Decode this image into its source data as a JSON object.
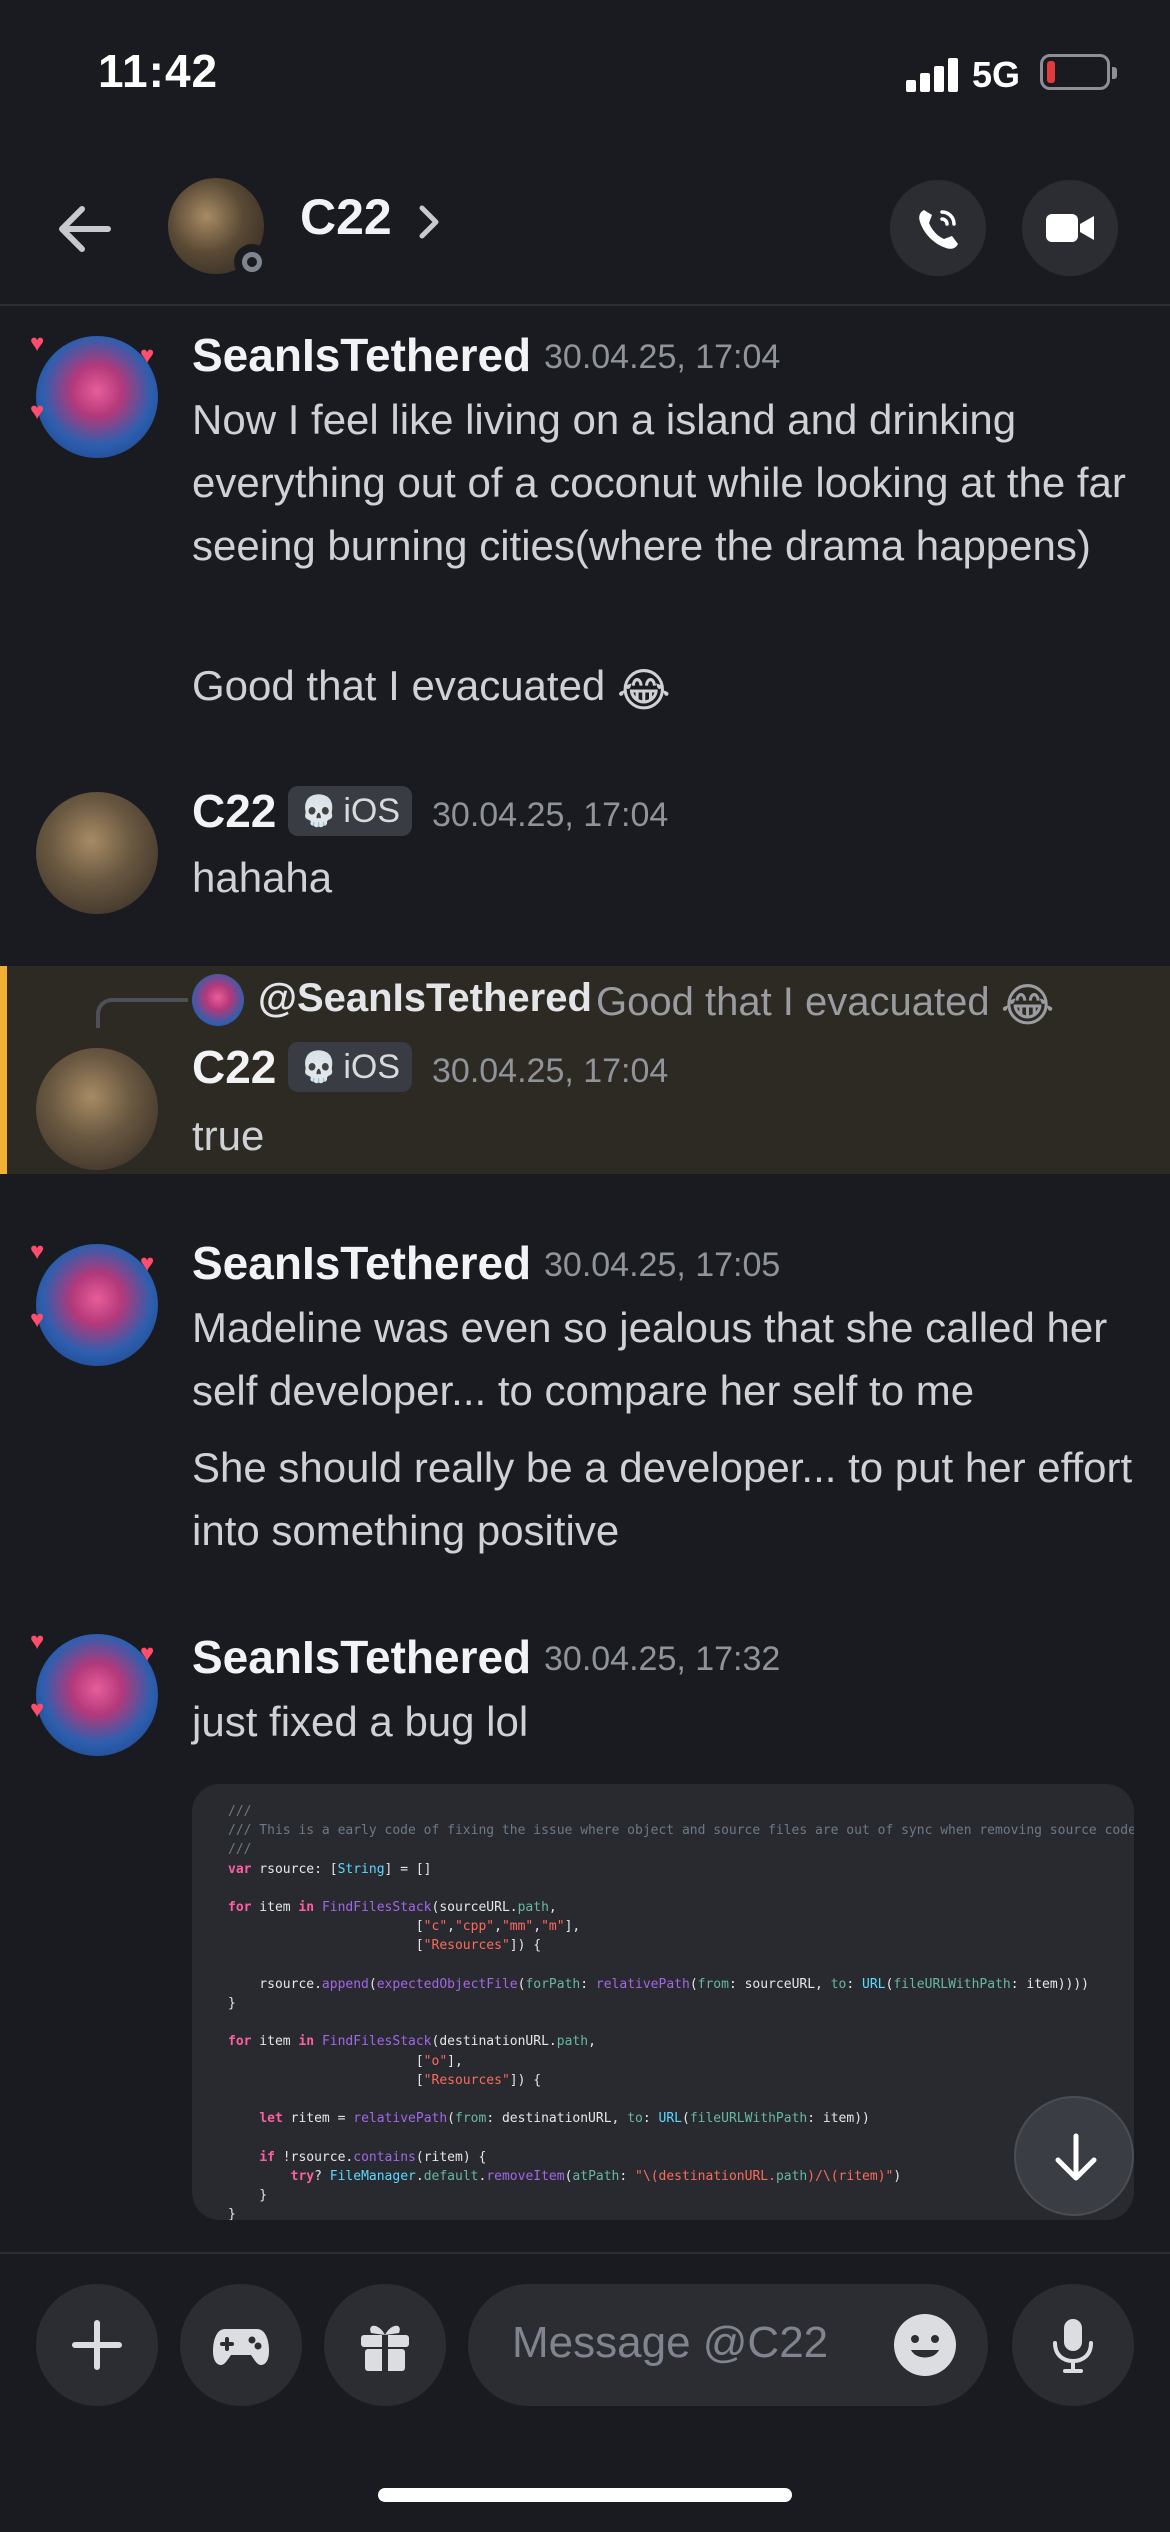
{
  "status_bar": {
    "time": "11:42",
    "network": "5G"
  },
  "header": {
    "title": "C22",
    "icons": {
      "back": "arrow-left-icon",
      "chevron": "chevron-right-icon",
      "call": "phone-icon",
      "video": "video-camera-icon"
    }
  },
  "messages": [
    {
      "author": "SeanIsTethered",
      "timestamp": "30.04.25, 17:04",
      "lines": [
        "Now I feel like living on a island and drinking everything out of a coconut while looking at the far seeing burning cities(where the drama happens)",
        "Good that I evacuated"
      ],
      "emoji": "😂"
    },
    {
      "author": "C22",
      "tag": "iOS",
      "timestamp": "30.04.25, 17:04",
      "lines": [
        "hahaha"
      ]
    },
    {
      "reply_to": {
        "author": "@SeanIsTethered",
        "preview": "Good that I evacuated",
        "emoji": "😂"
      },
      "author": "C22",
      "tag": "iOS",
      "timestamp": "30.04.25, 17:04",
      "lines": [
        "true"
      ]
    },
    {
      "author": "SeanIsTethered",
      "timestamp": "30.04.25, 17:05",
      "lines": [
        "Madeline was even so jealous that she called her self developer... to compare her self to me",
        "She should really be a developer... to put her effort into something positive"
      ]
    },
    {
      "author": "SeanIsTethered",
      "timestamp": "30.04.25, 17:32",
      "lines": [
        "just fixed a bug lol"
      ]
    }
  ],
  "code_image": {
    "lines": [
      "///",
      "/// This is a early code of fixing the issue where object and source files are out of sync when removing source code files",
      "///",
      "var rsource: [String] = []",
      "",
      "for item in FindFilesStack(sourceURL.path,",
      "                        [\"c\",\"cpp\",\"mm\",\"m\"],",
      "                        [\"Resources\"]) {",
      "",
      "    rsource.append(expectedObjectFile(forPath: relativePath(from: sourceURL, to: URL(fileURLWithPath: item))))",
      "}",
      "",
      "for item in FindFilesStack(destinationURL.path,",
      "                        [\"o\"],",
      "                        [\"Resources\"]) {",
      "",
      "    let ritem = relativePath(from: destinationURL, to: URL(fileURLWithPath: item))",
      "",
      "    if !rsource.contains(ritem) {",
      "        try? FileManager.default.removeItem(atPath: \"\\(destinationURL.path)/\\(ritem)\")",
      "    }",
      "}"
    ]
  },
  "composer": {
    "placeholder": "Message @C22",
    "icons": {
      "plus": "plus-icon",
      "game": "gamepad-icon",
      "gift": "gift-icon",
      "emoji": "smiley-icon",
      "mic": "microphone-icon"
    }
  },
  "colors": {
    "background": "#1a1b20",
    "reply_accent": "#f0b132",
    "reply_highlight": "#2c2a22",
    "tag_bg": "#3a3c43"
  }
}
